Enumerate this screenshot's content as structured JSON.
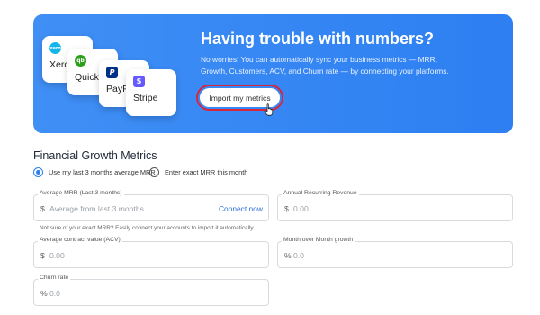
{
  "banner": {
    "title": "Having trouble with numbers?",
    "description": "No worries! You can automatically sync your business metrics — MRR, Growth, Customers, ACV, and Churn rate — by connecting your platforms.",
    "import_button": "Import my metrics",
    "integrations": [
      {
        "name": "Xero",
        "logo_text": "xero",
        "color": "#13b5ea"
      },
      {
        "name": "Quick",
        "logo_text": "qb",
        "color": "#2ca01c"
      },
      {
        "name": "PayPal",
        "logo_text": "P",
        "color": "#003087"
      },
      {
        "name": "Stripe",
        "logo_text": "S",
        "color": "#635bff"
      }
    ]
  },
  "section": {
    "title": "Financial Growth Metrics"
  },
  "mrr_options": [
    {
      "label": "Use my last 3 months average MRR",
      "selected": true
    },
    {
      "label": "Enter exact MRR this month",
      "selected": false
    }
  ],
  "fields": {
    "avg_mrr": {
      "label": "Average MRR (Last 3 months)",
      "prefix": "$",
      "placeholder": "Average from last 3 months",
      "action": "Connect now"
    },
    "arr": {
      "label": "Annual Recurring Revenue",
      "prefix": "$",
      "placeholder": "0.00"
    },
    "acv": {
      "label": "Average contract value (ACV)",
      "prefix": "$",
      "placeholder": "0.00"
    },
    "mom_growth": {
      "label": "Month over Month growth",
      "prefix": "%",
      "placeholder": "0.0"
    },
    "churn": {
      "label": "Churn rate",
      "prefix": "%",
      "placeholder": "0.0"
    }
  },
  "helper_text": "Not sure of your exact MRR? Easily connect your accounts to import it automatically.",
  "colors": {
    "accent": "#2d7ff2",
    "highlight_ring": "#d9253b"
  }
}
